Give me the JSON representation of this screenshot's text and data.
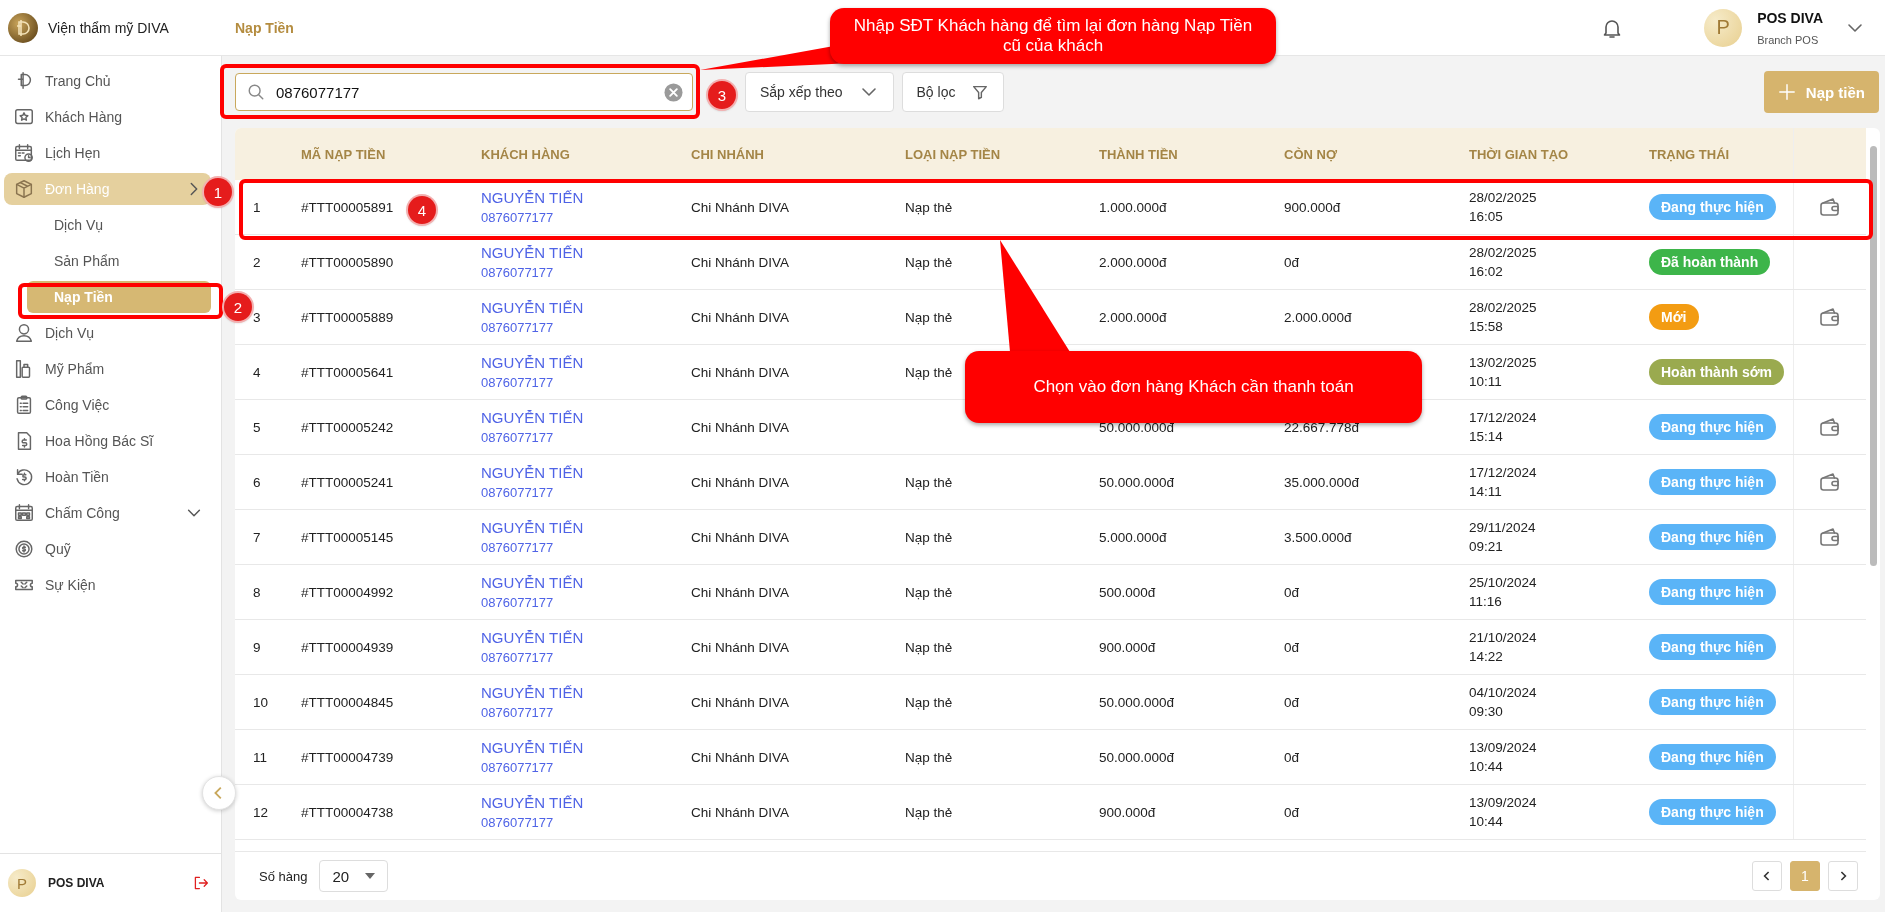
{
  "header": {
    "brand": "Viện thẩm mỹ DIVA",
    "page_title": "Nạp Tiền",
    "user": {
      "avatar": "P",
      "name": "POS DIVA",
      "role": "Branch POS"
    }
  },
  "sidebar": {
    "items": [
      {
        "label": "Trang Chủ",
        "selected": false
      },
      {
        "label": "Khách Hàng",
        "selected": false
      },
      {
        "label": "Lịch Hẹn",
        "selected": false
      },
      {
        "label": "Đơn Hàng",
        "selected": true,
        "expanded": true,
        "children": [
          {
            "label": "Dịch Vụ",
            "selected": false
          },
          {
            "label": "Sản Phẩm",
            "selected": false
          },
          {
            "label": "Nạp Tiền",
            "selected": true
          }
        ]
      },
      {
        "label": "Dịch Vụ",
        "selected": false
      },
      {
        "label": "Mỹ Phẩm",
        "selected": false
      },
      {
        "label": "Công Việc",
        "selected": false
      },
      {
        "label": "Hoa Hồng Bác Sĩ",
        "selected": false
      },
      {
        "label": "Hoàn Tiền",
        "selected": false
      },
      {
        "label": "Chấm Công",
        "selected": false,
        "expanded": false
      },
      {
        "label": "Quỹ",
        "selected": false
      },
      {
        "label": "Sự Kiện",
        "selected": false
      }
    ],
    "user": {
      "avatar": "P",
      "name": "POS DIVA"
    }
  },
  "toolbar": {
    "search": {
      "value": "0876077177"
    },
    "sort": "Sắp xếp theo",
    "filter": "Bộ lọc",
    "add": "Nạp tiền"
  },
  "table": {
    "columns": [
      "MÃ NẠP TIỀN",
      "KHÁCH HÀNG",
      "CHI NHÁNH",
      "LOẠI NẠP TIỀN",
      "THÀNH TIỀN",
      "CÒN NỢ",
      "THỜI GIAN TẠO",
      "TRẠNG THÁI"
    ],
    "rows": [
      {
        "index": "1",
        "code": "#TTT00005891",
        "customer": "NGUYỄN TIẾN",
        "phone": "0876077177",
        "branch": "Chi Nhánh DIVA",
        "type": "Nạp thẻ",
        "amount": "1.000.000đ",
        "debt": "900.000đ",
        "date": "28/02/2025",
        "time": "16:05",
        "status": "Đang thực hiện",
        "color": "#5ab4f7",
        "payable": true
      },
      {
        "index": "2",
        "code": "#TTT00005890",
        "customer": "NGUYỄN TIẾN",
        "phone": "0876077177",
        "branch": "Chi Nhánh DIVA",
        "type": "Nạp thẻ",
        "amount": "2.000.000đ",
        "debt": "0đ",
        "date": "28/02/2025",
        "time": "16:02",
        "status": "Đã hoàn thành",
        "color": "#3db54a",
        "payable": false
      },
      {
        "index": "3",
        "code": "#TTT00005889",
        "customer": "NGUYỄN TIẾN",
        "phone": "0876077177",
        "branch": "Chi Nhánh DIVA",
        "type": "Nạp thẻ",
        "amount": "2.000.000đ",
        "debt": "2.000.000đ",
        "date": "28/02/2025",
        "time": "15:58",
        "status": "Mới",
        "color": "#f39c12",
        "payable": true
      },
      {
        "index": "4",
        "code": "#TTT00005641",
        "customer": "NGUYỄN TIẾN",
        "phone": "0876077177",
        "branch": "Chi Nhánh DIVA",
        "type": "Nạp thẻ",
        "date": "13/02/2025",
        "time": "10:11",
        "status": "Hoàn thành sớm",
        "color": "#9aaa4f",
        "payable": false
      },
      {
        "index": "5",
        "code": "#TTT00005242",
        "customer": "NGUYỄN TIẾN",
        "phone": "0876077177",
        "branch": "Chi Nhánh DIVA",
        "amount": "50.000.000đ",
        "debt": "22.667.778đ",
        "date": "17/12/2024",
        "time": "15:14",
        "status": "Đang thực hiện",
        "color": "#5ab4f7",
        "payable": true
      },
      {
        "index": "6",
        "code": "#TTT00005241",
        "customer": "NGUYỄN TIẾN",
        "phone": "0876077177",
        "branch": "Chi Nhánh DIVA",
        "type": "Nạp thẻ",
        "amount": "50.000.000đ",
        "debt": "35.000.000đ",
        "date": "17/12/2024",
        "time": "14:11",
        "status": "Đang thực hiện",
        "color": "#5ab4f7",
        "payable": true
      },
      {
        "index": "7",
        "code": "#TTT00005145",
        "customer": "NGUYỄN TIẾN",
        "phone": "0876077177",
        "branch": "Chi Nhánh DIVA",
        "type": "Nạp thẻ",
        "amount": "5.000.000đ",
        "debt": "3.500.000đ",
        "date": "29/11/2024",
        "time": "09:21",
        "status": "Đang thực hiện",
        "color": "#5ab4f7",
        "payable": true
      },
      {
        "index": "8",
        "code": "#TTT00004992",
        "customer": "NGUYỄN TIẾN",
        "phone": "0876077177",
        "branch": "Chi Nhánh DIVA",
        "type": "Nạp thẻ",
        "amount": "500.000đ",
        "debt": "0đ",
        "date": "25/10/2024",
        "time": "11:16",
        "status": "Đang thực hiện",
        "color": "#5ab4f7",
        "payable": false
      },
      {
        "index": "9",
        "code": "#TTT00004939",
        "customer": "NGUYỄN TIẾN",
        "phone": "0876077177",
        "branch": "Chi Nhánh DIVA",
        "type": "Nạp thẻ",
        "amount": "900.000đ",
        "debt": "0đ",
        "date": "21/10/2024",
        "time": "14:22",
        "status": "Đang thực hiện",
        "color": "#5ab4f7",
        "payable": false
      },
      {
        "index": "10",
        "code": "#TTT00004845",
        "customer": "NGUYỄN TIẾN",
        "phone": "0876077177",
        "branch": "Chi Nhánh DIVA",
        "type": "Nạp thẻ",
        "amount": "50.000.000đ",
        "debt": "0đ",
        "date": "04/10/2024",
        "time": "09:30",
        "status": "Đang thực hiện",
        "color": "#5ab4f7",
        "payable": false
      },
      {
        "index": "11",
        "code": "#TTT00004739",
        "customer": "NGUYỄN TIẾN",
        "phone": "0876077177",
        "branch": "Chi Nhánh DIVA",
        "type": "Nạp thẻ",
        "amount": "50.000.000đ",
        "debt": "0đ",
        "date": "13/09/2024",
        "time": "10:44",
        "status": "Đang thực hiện",
        "color": "#5ab4f7",
        "payable": false
      },
      {
        "index": "12",
        "code": "#TTT00004738",
        "customer": "NGUYỄN TIẾN",
        "phone": "0876077177",
        "branch": "Chi Nhánh DIVA",
        "type": "Nạp thẻ",
        "amount": "900.000đ",
        "debt": "0đ",
        "date": "13/09/2024",
        "time": "10:44",
        "status": "Đang thực hiện",
        "color": "#5ab4f7",
        "payable": false
      }
    ]
  },
  "footer": {
    "rows_label": "Số hàng",
    "rows_value": "20",
    "pages": [
      {
        "label": "1",
        "selected": true
      }
    ]
  },
  "annotations": {
    "callouts": [
      "Nhập SĐT Khách hàng để tìm lại đơn hàng Nạp Tiền cũ của khách",
      "Chọn vào đơn hàng Khách cần thanh toán"
    ],
    "badges": [
      "1",
      "2",
      "3",
      "4"
    ]
  }
}
